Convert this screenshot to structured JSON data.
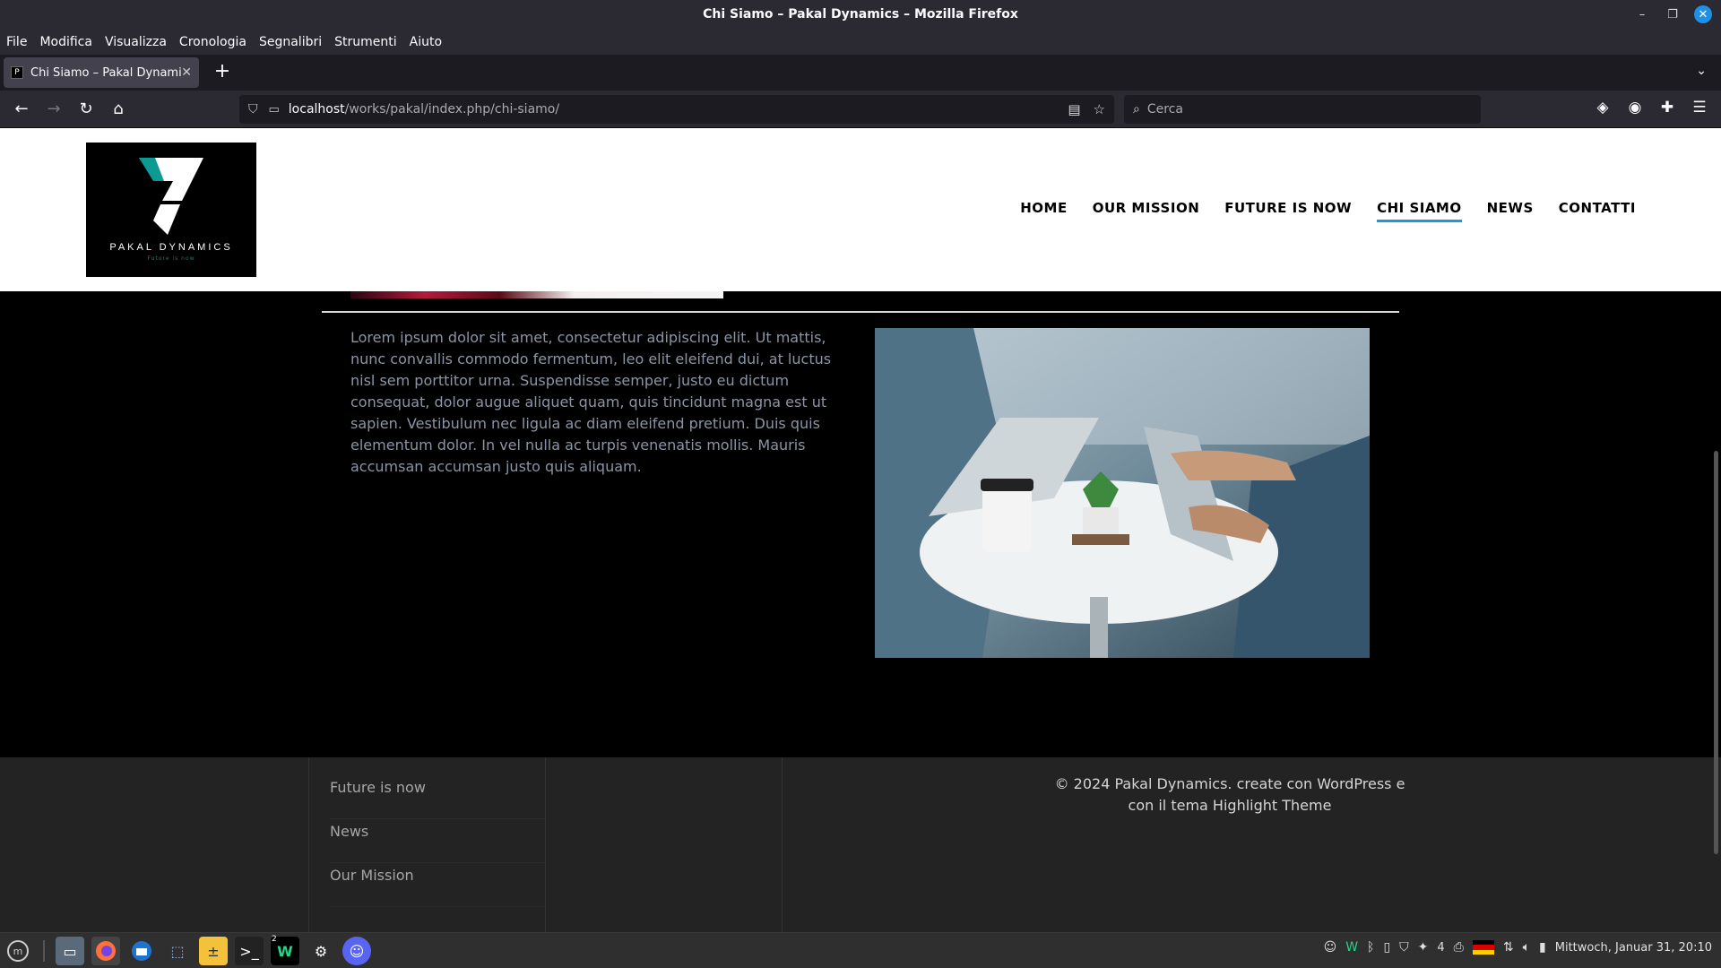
{
  "window": {
    "title": "Chi Siamo – Pakal Dynamics – Mozilla Firefox"
  },
  "menu": [
    "File",
    "Modifica",
    "Visualizza",
    "Cronologia",
    "Segnalibri",
    "Strumenti",
    "Aiuto"
  ],
  "tab": {
    "title": "Chi Siamo – Pakal Dynamics"
  },
  "url": {
    "host": "localhost",
    "path": "/works/pakal/index.php/chi-siamo/"
  },
  "search": {
    "placeholder": "Cerca"
  },
  "site": {
    "logo_text": "PAKAL DYNAMICS",
    "logo_tagline": "Future is now",
    "nav": [
      "HOME",
      "OUR MISSION",
      "FUTURE IS NOW",
      "CHI SIAMO",
      "NEWS",
      "CONTATTI"
    ],
    "active_nav": "CHI SIAMO",
    "body_text": "Lorem ipsum dolor sit amet, consectetur adipiscing elit. Ut mattis, nunc convallis commodo fermentum, leo elit eleifend dui, at luctus nisl sem porttitor urna. Suspendisse semper, justo eu dictum consequat, dolor augue aliquet quam, quis tincidunt magna est ut sapien. Vestibulum nec ligula ac diam eleifend pretium. Duis quis elementum dolor. In vel nulla ac turpis venenatis mollis. Mauris accumsan accumsan justo quis aliquam."
  },
  "footer": {
    "links": [
      "Future is now",
      "News",
      "Our Mission"
    ],
    "copyright_line1": "©  2024 Pakal Dynamics. create con WordPress e",
    "copyright_line2": "con il tema Highlight Theme"
  },
  "taskbar": {
    "clock": "Mittwoch, Januar 31, 20:10",
    "badge_count": "2",
    "tray_count": "4"
  }
}
